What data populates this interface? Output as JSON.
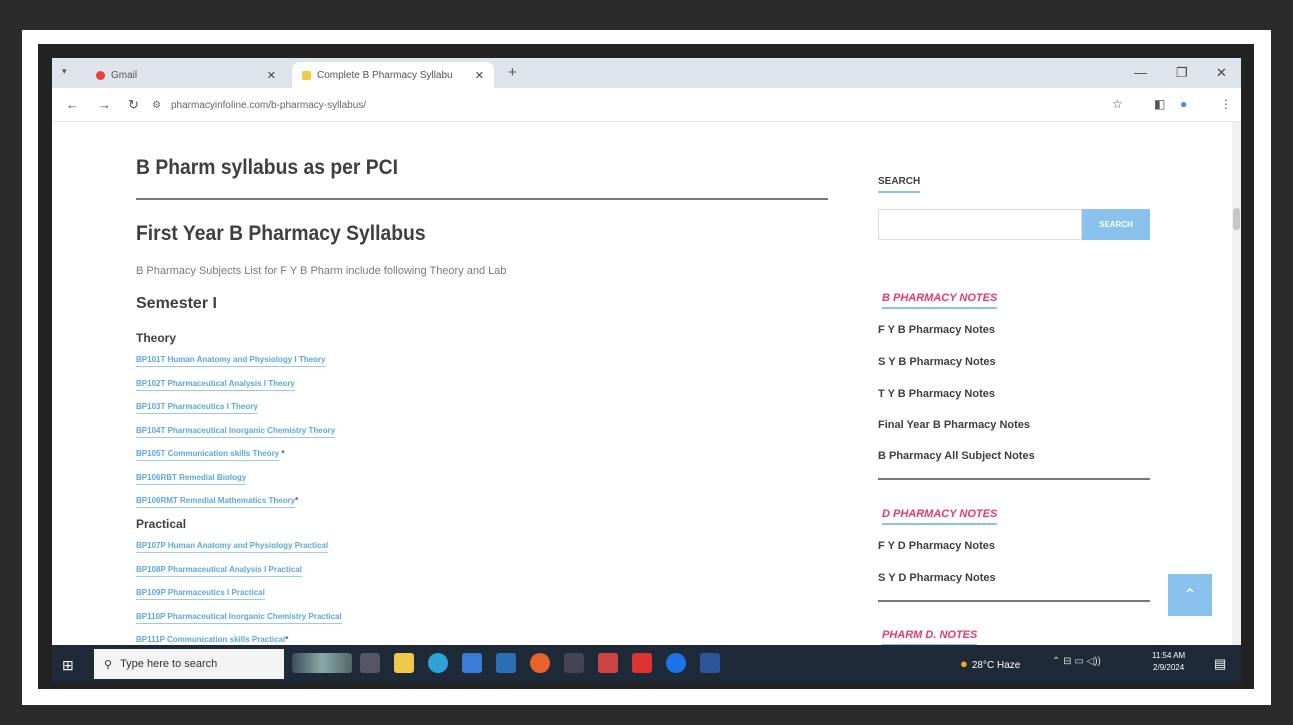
{
  "browser": {
    "tabs": [
      {
        "title": "Gmail",
        "active": false
      },
      {
        "title": "Complete B Pharmacy Syllabu",
        "active": true
      }
    ],
    "new_tab": "+",
    "url": "pharmacyinfoline.com/b-pharmacy-syllabus/"
  },
  "page": {
    "heading": "B Pharm syllabus as per PCI",
    "section_title": "First Year B Pharmacy Syllabus",
    "subtitle": "B Pharmacy Subjects List for F Y B Pharm include following Theory and Lab",
    "semester": "Semester I",
    "theory_label": "Theory",
    "theory_links": [
      {
        "text": "BP101T Human Anatomy and Physiology I Theory",
        "suffix": ""
      },
      {
        "text": "BP102T Pharmaceutical Analysis I Theory",
        "suffix": ""
      },
      {
        "text": "BP103T Pharmaceutics I Theory",
        "suffix": ""
      },
      {
        "text": "BP104T Pharmaceutical Inorganic Chemistry Theory",
        "suffix": ""
      },
      {
        "text": "BP105T Communication skills Theory",
        "suffix": " *"
      },
      {
        "text": "BP106RBT Remedial Biology",
        "suffix": ""
      },
      {
        "text": "BP106RMT Remedial Mathematics Theory",
        "suffix": "*"
      }
    ],
    "practical_label": "Practical",
    "practical_links": [
      {
        "text": "BP107P Human Anatomy and Physiology Practical",
        "suffix": ""
      },
      {
        "text": "BP108P Pharmaceutical Analysis I Practical",
        "suffix": ""
      },
      {
        "text": "BP109P Pharmaceutics I Practical",
        "suffix": ""
      },
      {
        "text": "BP110P Pharmaceutical Inorganic Chemistry Practical",
        "suffix": ""
      },
      {
        "text": "BP111P Communication skills Practical",
        "suffix": "*"
      }
    ]
  },
  "sidebar": {
    "search_title": "SEARCH",
    "search_button": "SEARCH",
    "search_value": "",
    "widget1_title": "B PHARMACY NOTES",
    "widget1_links": [
      "F Y B Pharmacy Notes",
      "S Y B Pharmacy Notes",
      "T Y B Pharmacy Notes",
      "Final Year B Pharmacy Notes",
      "B Pharmacy All Subject Notes"
    ],
    "widget2_title": "D PHARMACY NOTES",
    "widget2_links": [
      "F Y D Pharmacy Notes",
      "S Y D Pharmacy Notes"
    ],
    "widget3_title": "PHARM D. NOTES"
  },
  "taskbar": {
    "search_placeholder": "Type here to search",
    "weather": "28°C Haze",
    "time": "11:54 AM",
    "date": "2/9/2024"
  },
  "colors": {
    "accent": "#8ac2ee",
    "link": "#5ca7e0",
    "widget_title": "#e63b6a",
    "taskbar": "#1f2a38"
  }
}
